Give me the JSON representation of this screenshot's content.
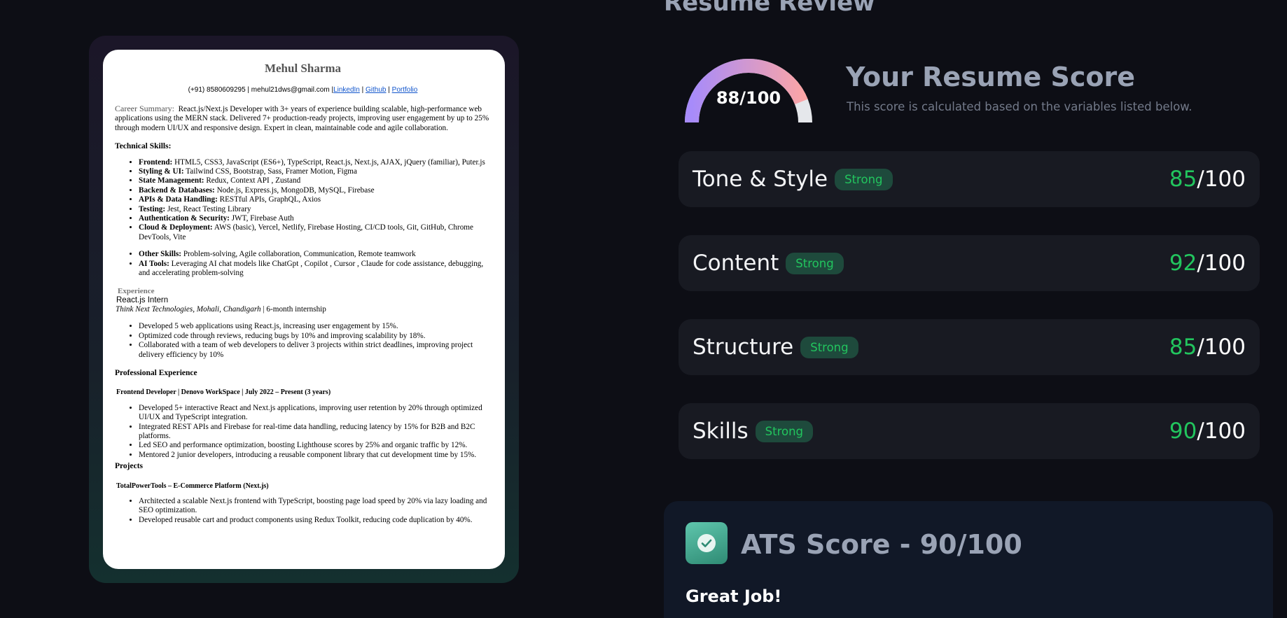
{
  "page": {
    "title": "Resume Review"
  },
  "resume": {
    "name": "Mehul Sharma",
    "contact": "(+91) 8580609295 | mehul21dws@gmail.com |",
    "links": [
      "LinkedIn",
      "Github",
      "Portfolio"
    ],
    "summary_label": "Career Summary:",
    "summary_text": "React.js/Next.js Developer with 3+ years of experience building scalable, high-performance web applications using the MERN stack. Delivered 7+ production-ready projects, improving user engagement by up to 25% through modern UI/UX and responsive design. Expert in clean, maintainable code and agile collaboration.",
    "skills_heading": "Technical Skills:",
    "skills": [
      {
        "label": "Frontend:",
        "text": "HTML5, CSS3, JavaScript (ES6+), TypeScript, React.js, Next.js, AJAX, jQuery (familiar), Puter.js"
      },
      {
        "label": "Styling & UI:",
        "text": "Tailwind CSS, Bootstrap, Sass, Framer Motion, Figma"
      },
      {
        "label": "State Management:",
        "text": "Redux, Context API , Zustand"
      },
      {
        "label": "Backend & Databases:",
        "text": "Node.js, Express.js, MongoDB, MySQL, Firebase"
      },
      {
        "label": "APIs & Data Handling:",
        "text": "RESTful APIs, GraphQL, Axios"
      },
      {
        "label": "Testing:",
        "text": "Jest, React Testing Library"
      },
      {
        "label": "Authentication & Security:",
        "text": "JWT, Firebase Auth"
      },
      {
        "label": "Cloud & Deployment:",
        "text": "AWS (basic), Vercel, Netlify, Firebase Hosting, CI/CD tools, Git, GitHub, Chrome DevTools, Vite"
      }
    ],
    "other_skills": [
      {
        "label": "Other Skills:",
        "text": "Problem-solving, Agile collaboration, Communication, Remote teamwork"
      },
      {
        "label": "AI Tools:",
        "text": "Leveraging AI chat models like ChatGpt , Copilot , Cursor , Claude for code assistance, debugging, and accelerating problem-solving"
      }
    ],
    "experience_label": "Experience",
    "intern_role": "React.js Intern",
    "intern_company": "Think Next Technologies, Mohali, Chandigarh",
    "intern_duration": " | 6-month internship",
    "intern_points": [
      "Developed 5 web applications using React.js, increasing user engagement by 15%.",
      "Optimized code through reviews, reducing bugs by 10% and improving scalability by 18%.",
      "Collaborated with a team of web developers to deliver 3 projects within strict deadlines, improving project delivery efficiency by 10%"
    ],
    "prof_heading": "Professional Experience",
    "prof_role": "Frontend Developer | Denovo WorkSpace | July 2022 – Present (3 years)",
    "prof_points": [
      "Developed 5+ interactive React and Next.js applications, improving user retention by 20% through optimized UI/UX and TypeScript integration.",
      "Integrated REST APIs and Firebase for real-time data handling, reducing latency by 15% for B2B and B2C platforms.",
      "Led SEO and performance optimization, boosting Lighthouse scores by 25% and organic traffic by 12%.",
      "Mentored 2 junior developers, introducing a reusable component library that cut development time by 15%."
    ],
    "projects_heading": "Projects",
    "project_title": "TotalPowerTools – E-Commerce Platform (Next.js)",
    "project_points": [
      "Architected a scalable Next.js frontend with TypeScript, boosting page load speed by 20% via lazy loading and SEO optimization.",
      "Developed reusable cart and product components using Redux Toolkit, reducing code duplication by 40%."
    ]
  },
  "score": {
    "overall": 88,
    "max": 100,
    "label": "88/100",
    "title": "Your Resume Score",
    "description": "This score is calculated based on the variables listed below."
  },
  "categories": [
    {
      "name": "Tone & Style",
      "badge": "Strong",
      "score": "85",
      "suffix": "/100"
    },
    {
      "name": "Content",
      "badge": "Strong",
      "score": "92",
      "suffix": "/100"
    },
    {
      "name": "Structure",
      "badge": "Strong",
      "score": "85",
      "suffix": "/100"
    },
    {
      "name": "Skills",
      "badge": "Strong",
      "score": "90",
      "suffix": "/100"
    }
  ],
  "ats": {
    "title": "ATS Score - 90/100",
    "subtitle": "Great Job!",
    "icon": "check-circle-icon"
  },
  "colors": {
    "background": "#0d0e15",
    "card": "#181a22",
    "accent_green": "#22c55e",
    "gauge_start": "#a78bfa",
    "gauge_end": "#fca5a5"
  }
}
